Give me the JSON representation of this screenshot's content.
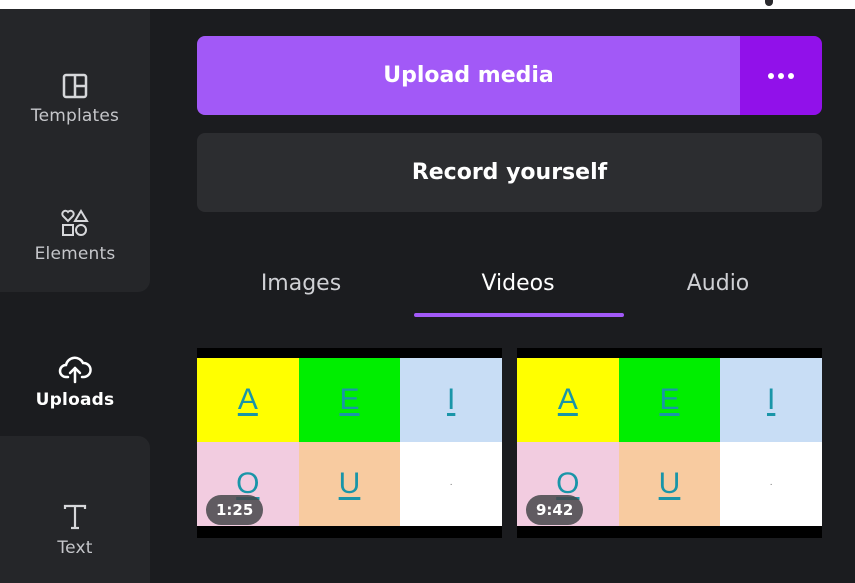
{
  "sidebar": {
    "items": [
      {
        "label": "Templates",
        "icon": "templates-icon"
      },
      {
        "label": "Elements",
        "icon": "elements-icon"
      },
      {
        "label": "Uploads",
        "icon": "uploads-icon",
        "active": true
      },
      {
        "label": "Text",
        "icon": "text-icon"
      }
    ]
  },
  "panel": {
    "upload_label": "Upload media",
    "more_icon": "more-dots-icon",
    "record_label": "Record yourself",
    "tabs": [
      {
        "label": "Images"
      },
      {
        "label": "Videos",
        "active": true
      },
      {
        "label": "Audio"
      }
    ],
    "videos": [
      {
        "duration": "1:25",
        "cells": [
          {
            "text": "A",
            "bg": "#ffff00"
          },
          {
            "text": "E",
            "bg": "#00ee00"
          },
          {
            "text": "I",
            "bg": "#c8ddf5"
          },
          {
            "text": "O",
            "bg": "#f2cce0"
          },
          {
            "text": "U",
            "bg": "#f8cba0"
          },
          {
            "text": "·",
            "bg": "#ffffff"
          }
        ]
      },
      {
        "duration": "9:42",
        "cells": [
          {
            "text": "A",
            "bg": "#ffff00"
          },
          {
            "text": "E",
            "bg": "#00ee00"
          },
          {
            "text": "I",
            "bg": "#c8ddf5"
          },
          {
            "text": "O",
            "bg": "#f2cce0"
          },
          {
            "text": "U",
            "bg": "#f8cba0"
          },
          {
            "text": "·",
            "bg": "#ffffff"
          }
        ]
      }
    ]
  },
  "colors": {
    "accent": "#a259f7",
    "accent_dark": "#9111ea",
    "background": "#1b1c1f",
    "sidebar_group": "#252629"
  }
}
